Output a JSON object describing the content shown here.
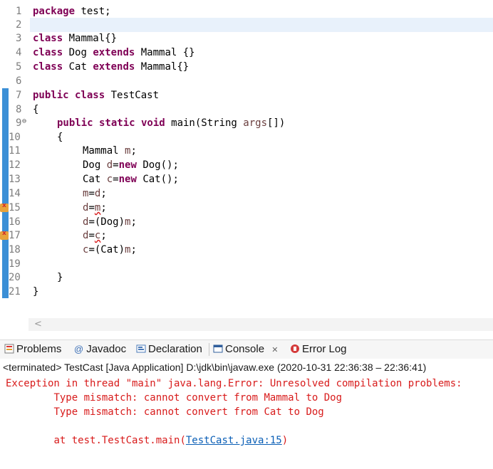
{
  "editor": {
    "line_numbers": [
      "1",
      "2",
      "3",
      "4",
      "5",
      "6",
      "7",
      "8",
      "9",
      "10",
      "11",
      "12",
      "13",
      "14",
      "15",
      "16",
      "17",
      "18",
      "19",
      "20",
      "21"
    ],
    "fold_marker": "⊖",
    "code": {
      "l1_kw": "package",
      "l1_rest": " test;",
      "l3_kw": "class",
      "l3_rest": " Mammal{}",
      "l4_kw1": "class",
      "l4_mid": " Dog ",
      "l4_kw2": "extends",
      "l4_rest": " Mammal {}",
      "l5_kw1": "class",
      "l5_mid": " Cat ",
      "l5_kw2": "extends",
      "l5_rest": " Mammal{}",
      "l7_kw": "public class",
      "l7_rest": " TestCast",
      "l8": "{",
      "l9_kw": "public static void",
      "l9_mid": " main(String ",
      "l9_var": "args",
      "l9_rest": "[])",
      "l10": "{",
      "l11_a": "Mammal ",
      "l11_var": "m",
      "l11_b": ";",
      "l12_a": "Dog ",
      "l12_var": "d",
      "l12_b": "=",
      "l12_kw": "new",
      "l12_c": " Dog();",
      "l13_a": "Cat ",
      "l13_var": "c",
      "l13_b": "=",
      "l13_kw": "new",
      "l13_c": " Cat();",
      "l14_a": "m",
      "l14_b": "=",
      "l14_c": "d",
      "l14_d": ";",
      "l15_a": "d",
      "l15_b": "=",
      "l15_c": "m",
      "l15_d": ";",
      "l16_a": "d",
      "l16_b": "=(Dog)",
      "l16_c": "m",
      "l16_d": ";",
      "l17_a": "d",
      "l17_b": "=",
      "l17_c": "c",
      "l17_d": ";",
      "l18_a": "c",
      "l18_b": "=(Cat)",
      "l18_c": "m",
      "l18_d": ";",
      "l20": "}",
      "l21": "}"
    },
    "scroll_arrow": "<"
  },
  "tabs": [
    {
      "label": "Problems"
    },
    {
      "label": "Javadoc"
    },
    {
      "label": "Declaration"
    },
    {
      "label": "Console",
      "close": "✕"
    },
    {
      "label": "Error Log"
    }
  ],
  "tab_icon_glyphs": {
    "javadoc": "@"
  },
  "console": {
    "status": "<terminated> TestCast [Java Application] D:\\jdk\\bin\\javaw.exe  (2020-10-31 22:36:38 – 22:36:41)",
    "line1": "Exception in thread \"main\" java.lang.Error: Unresolved compilation problems: ",
    "line2": "\tType mismatch: cannot convert from Mammal to Dog",
    "line3": "\tType mismatch: cannot convert from Cat to Dog",
    "line5_prefix": "\tat test.TestCast.main(",
    "line5_link": "TestCast.java:15",
    "line5_suffix": ")"
  },
  "colors": {
    "keyword": "#7f0055",
    "variable": "#6a3e3e",
    "error_text": "#d81b1b",
    "link": "#0b5fb6",
    "ruler": "#3b8fd6",
    "error_marker": "#e8a33b"
  }
}
